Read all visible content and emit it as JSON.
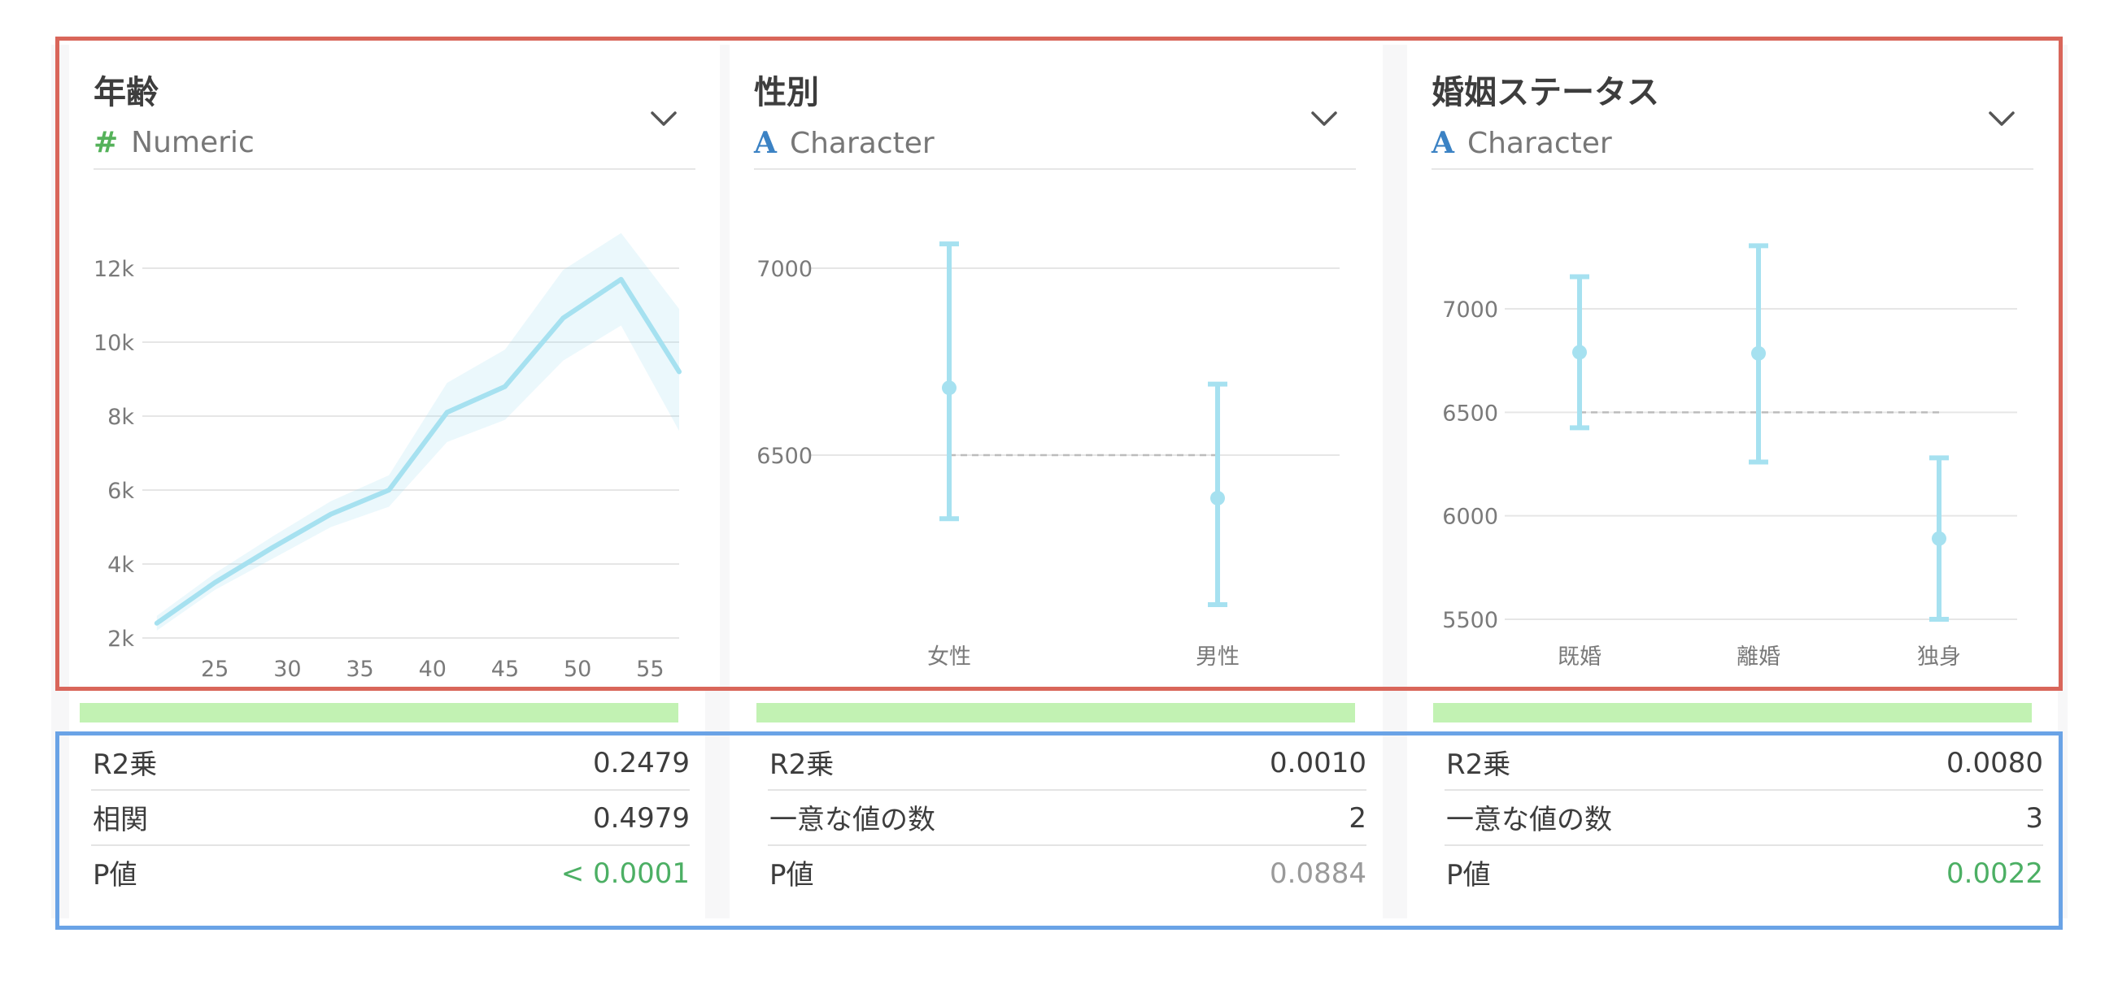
{
  "cards": [
    {
      "title": "年齢",
      "type_symbol": "#",
      "type_label": "Numeric",
      "type_color": "#55b25a",
      "chart_data": {
        "type": "line",
        "x": [
          21,
          25,
          29,
          33,
          37,
          41,
          45,
          49,
          53,
          57
        ],
        "y": [
          2400,
          3500,
          4450,
          5350,
          6000,
          8100,
          8800,
          10650,
          11700,
          9200
        ],
        "y_lower": [
          2200,
          3300,
          4150,
          5000,
          5550,
          7300,
          7900,
          9500,
          10450,
          7600
        ],
        "y_upper": [
          2600,
          3750,
          4750,
          5700,
          6400,
          8900,
          9800,
          11950,
          12950,
          10900
        ],
        "xlim": [
          20,
          57
        ],
        "ylim": [
          2000,
          13000
        ],
        "x_ticks": [
          25,
          30,
          35,
          40,
          45,
          50,
          55
        ],
        "y_ticks": [
          2000,
          4000,
          6000,
          8000,
          10000,
          12000
        ],
        "y_tick_labels": [
          "2k",
          "4k",
          "6k",
          "8k",
          "10k",
          "12k"
        ],
        "grid": true,
        "color": "#a6e1f0"
      },
      "stats": [
        {
          "label": "R2乗",
          "value": "0.2479",
          "color": "#3d3d3d"
        },
        {
          "label": "相関",
          "value": "0.4979",
          "color": "#3d3d3d"
        },
        {
          "label": "P値",
          "value": "< 0.0001",
          "color": "#4caf64"
        }
      ]
    },
    {
      "title": "性別",
      "type_symbol": "A",
      "type_label": "Character",
      "type_color": "#3b82c4",
      "chart_data": {
        "type": "errorbar",
        "categories": [
          "女性",
          "男性"
        ],
        "mean": [
          6680,
          6385
        ],
        "lower": [
          6330,
          6100
        ],
        "upper": [
          7065,
          6690
        ],
        "reference": 6500,
        "ylim": [
          6080,
          7100
        ],
        "y_ticks": [
          6500,
          7000
        ],
        "y_tick_labels": [
          "6500",
          "7000"
        ],
        "grid": true,
        "color": "#a6e1f0"
      },
      "stats": [
        {
          "label": "R2乗",
          "value": "0.0010",
          "color": "#3d3d3d"
        },
        {
          "label": "一意な値の数",
          "value": "2",
          "color": "#3d3d3d"
        },
        {
          "label": "P値",
          "value": "0.0884",
          "color": "#9a9a9a"
        }
      ]
    },
    {
      "title": "婚姻ステータス",
      "type_symbol": "A",
      "type_label": "Character",
      "type_color": "#3b82c4",
      "chart_data": {
        "type": "errorbar",
        "categories": [
          "既婚",
          "離婚",
          "独身"
        ],
        "mean": [
          6790,
          6785,
          5890
        ],
        "lower": [
          6425,
          6260,
          5500
        ],
        "upper": [
          7155,
          7305,
          6280
        ],
        "reference": 6500,
        "ylim": [
          5450,
          7400
        ],
        "y_ticks": [
          5500,
          6000,
          6500,
          7000
        ],
        "y_tick_labels": [
          "5500",
          "6000",
          "6500",
          "7000"
        ],
        "grid": true,
        "color": "#a6e1f0"
      },
      "stats": [
        {
          "label": "R2乗",
          "value": "0.0080",
          "color": "#3d3d3d"
        },
        {
          "label": "一意な値の数",
          "value": "3",
          "color": "#3d3d3d"
        },
        {
          "label": "P値",
          "value": "0.0022",
          "color": "#4caf64"
        }
      ]
    }
  ]
}
